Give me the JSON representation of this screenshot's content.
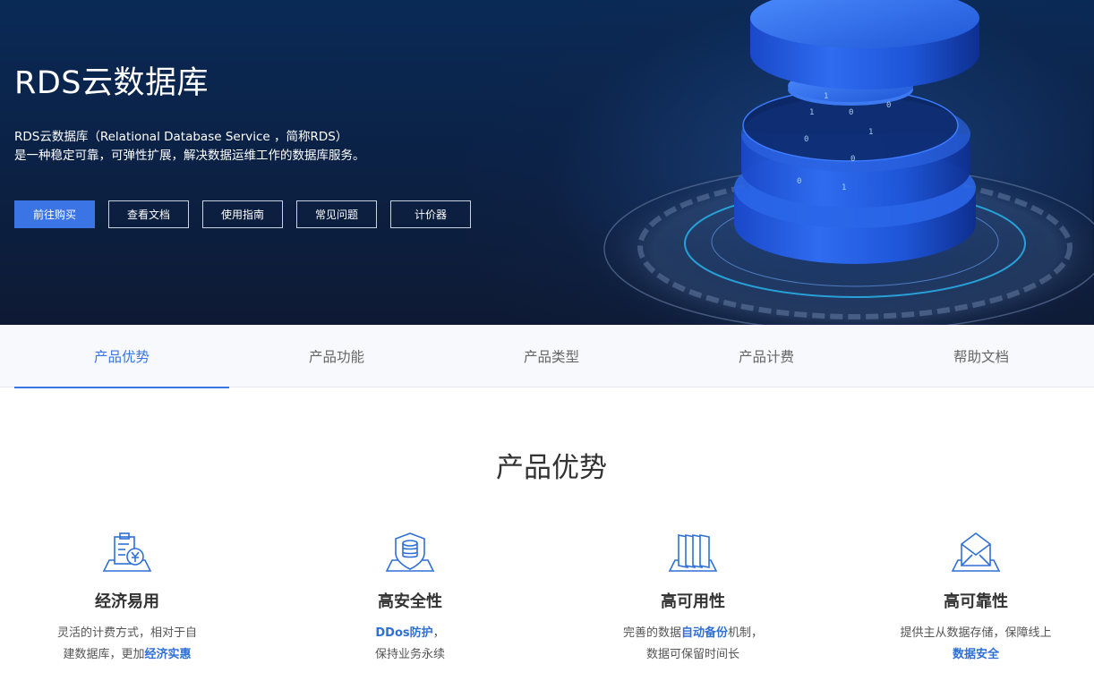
{
  "hero": {
    "title": "RDS云数据库",
    "desc_line1": "RDS云数据库（Relational Database Service ，简称RDS）",
    "desc_line2": "是一种稳定可靠，可弹性扩展，解决数据运维工作的数据库服务。",
    "buttons": [
      {
        "label": "前往购买"
      },
      {
        "label": "查看文档"
      },
      {
        "label": "使用指南"
      },
      {
        "label": "常见问题"
      },
      {
        "label": "计价器"
      }
    ]
  },
  "tabs": [
    {
      "label": "产品优势"
    },
    {
      "label": "产品功能"
    },
    {
      "label": "产品类型"
    },
    {
      "label": "产品计费"
    },
    {
      "label": "帮助文档"
    }
  ],
  "section": {
    "title": "产品优势"
  },
  "features": [
    {
      "icon": "money-document-icon",
      "title": "经济易用",
      "line1": "灵活的计费方式，相对于自",
      "line2_pre": "建数据库，更加",
      "line2_hl": "经济实惠"
    },
    {
      "icon": "database-shield-icon",
      "title": "高安全性",
      "line1_hl": "DDos防护",
      "line1_post": "，",
      "line2": "保持业务永续"
    },
    {
      "icon": "stacked-pages-icon",
      "title": "高可用性",
      "line1_pre": "完善的数据",
      "line1_hl": "自动备份",
      "line1_post": "机制，",
      "line2": "数据可保留时间长"
    },
    {
      "icon": "envelope-icon",
      "title": "高可靠性",
      "line1": "提供主从数据存储，保障线上",
      "line2_hl": "数据安全"
    }
  ],
  "colors": {
    "accent": "#3b74e4",
    "hero_bg": "#0b2247",
    "highlight": "#2f6fd6"
  }
}
